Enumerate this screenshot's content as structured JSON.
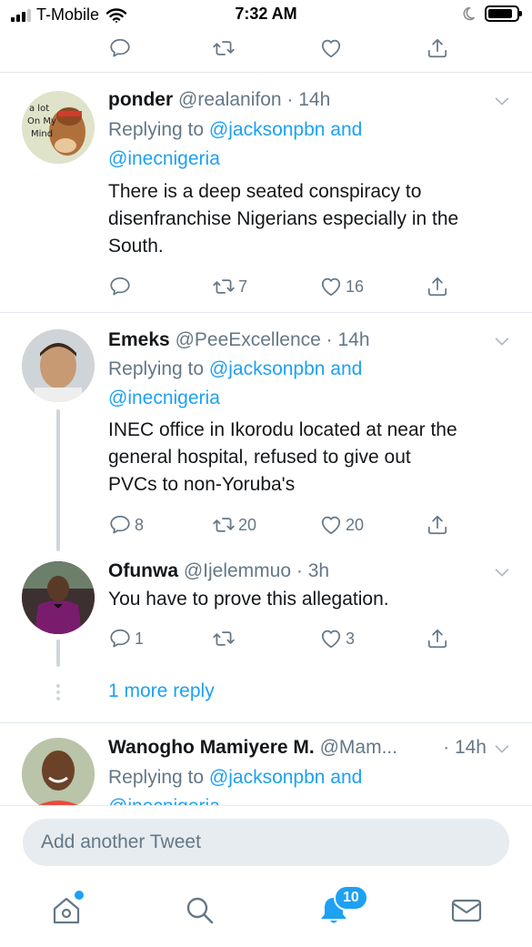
{
  "status_bar": {
    "carrier": "T-Mobile",
    "time": "7:32 AM"
  },
  "tweets": [
    {
      "name": "ponder",
      "handle": "@realanifon",
      "time_ago": "· 14h",
      "replying_label": "Replying to",
      "replying_mentions": "@jacksonpbn and",
      "replying_mentions2": "@inecnigeria",
      "body_lines": [
        "There is a deep seated conspiracy to",
        "disenfranchise Nigerians especially in the",
        "South."
      ],
      "retweets": "7",
      "likes": "16",
      "avatar_text": [
        "a lot",
        "On My",
        "Mind"
      ]
    },
    {
      "name": "Emeks",
      "handle": "@PeeExcellence",
      "time_ago": "· 14h",
      "replying_label": "Replying to",
      "replying_mentions": "@jacksonpbn and",
      "replying_mentions2": "@inecnigeria",
      "body_lines": [
        "INEC office in Ikorodu located at near the",
        "general hospital, refused to give out",
        "PVCs to non-Yoruba's"
      ],
      "replies": "8",
      "retweets": "20",
      "likes": "20"
    },
    {
      "name": "Ofunwa",
      "handle": "@Ijelemmuo",
      "time_ago": "· 3h",
      "body_lines": [
        "You have to prove this allegation."
      ],
      "replies": "1",
      "likes": "3"
    },
    {
      "name": "Wanogho Mamiyere M.",
      "handle": "@Mam...",
      "time_ago": "· 14h",
      "replying_label": "Replying to",
      "replying_mentions": "@jacksonpbn and",
      "replying_mentions2": "@inecnigeria"
    }
  ],
  "more_replies_label": "1 more reply",
  "compose": {
    "placeholder": "Add another Tweet"
  },
  "tabbar": {
    "notifications_badge": "10"
  },
  "icons": {
    "reply": "reply-icon",
    "retweet": "retweet-icon",
    "like": "heart-icon",
    "share": "share-icon",
    "chevron": "chevron-down-icon",
    "home": "home-icon",
    "search": "search-icon",
    "notifications": "bell-icon",
    "messages": "mail-icon"
  },
  "colors": {
    "accent": "#1da1f2",
    "muted": "#657786",
    "text": "#14171a",
    "divider": "#e1e8ed"
  }
}
